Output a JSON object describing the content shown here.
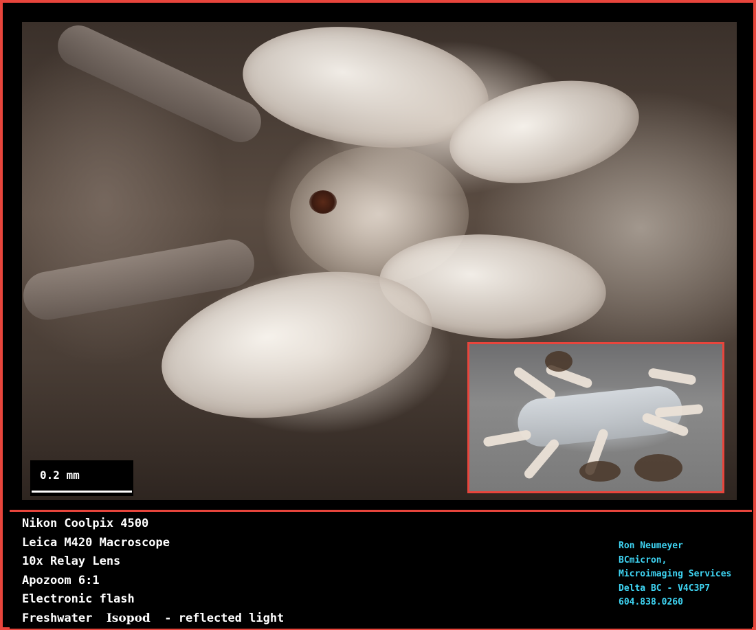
{
  "scale_bar": {
    "label": "0.2 mm"
  },
  "caption": {
    "camera": "Nikon Coolpix 4500",
    "microscope": "Leica M420 Macroscope",
    "lens": "10x Relay Lens",
    "zoom": "Apozoom 6:1",
    "lighting": "Electronic flash",
    "subject_prefix": "Freshwater ",
    "subject_name": "Isopod",
    "subject_suffix": "  - reflected light"
  },
  "credit": {
    "name": "Ron Neumeyer",
    "company": "BCmicron,",
    "service": "Microimaging Services",
    "location": "Delta BC - V4C3P7",
    "phone": "604.838.0260"
  },
  "colors": {
    "frame_border": "#e8453c",
    "credit_text": "#3fd6f5",
    "caption_text": "#ffffff",
    "background": "#000000"
  }
}
